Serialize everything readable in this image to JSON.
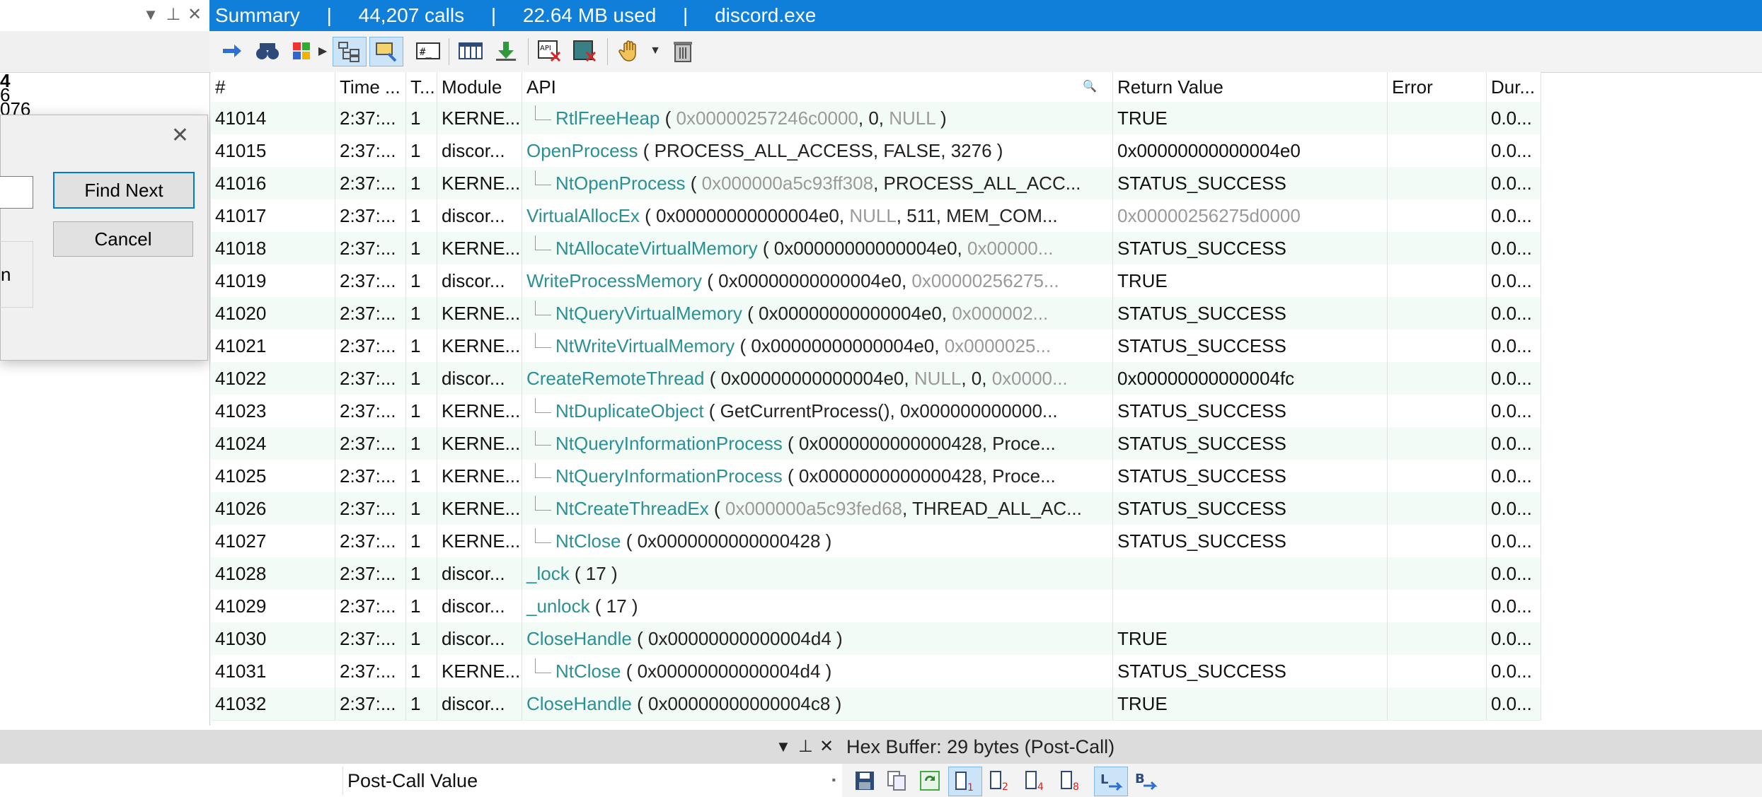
{
  "summary": {
    "title": "Summary",
    "calls": "44,207 calls",
    "memory": "22.64 MB used",
    "process": "discord.exe",
    "sep": "|"
  },
  "left_fragment": {
    "line1": "4",
    "line2": "6",
    "line3": "076"
  },
  "find_dialog": {
    "find_next": "Find Next",
    "cancel": "Cancel",
    "group_label_fragment": "n",
    "close_glyph": "✕"
  },
  "columns": {
    "num": "#",
    "time": "Time ...",
    "thread": "T...",
    "module": "Module",
    "api": "API",
    "ret": "Return Value",
    "error": "Error",
    "dur": "Dur..."
  },
  "rows": [
    {
      "num": "41014",
      "time": "2:37:...",
      "thread": "1",
      "module": "KERNE...",
      "indent": true,
      "name": "RtlFreeHeap",
      "args": [
        {
          "t": " ( ",
          "m": false
        },
        {
          "t": "0x00000257246c0000",
          "m": true
        },
        {
          "t": ", 0, ",
          "m": false
        },
        {
          "t": "NULL",
          "m": true
        },
        {
          "t": " )",
          "m": false
        }
      ],
      "ret": "TRUE",
      "ret_muted": false,
      "dur": "0.0..."
    },
    {
      "num": "41015",
      "time": "2:37:...",
      "thread": "1",
      "module": "discor...",
      "indent": false,
      "name": "OpenProcess",
      "args": [
        {
          "t": " ( PROCESS_ALL_ACCESS, FALSE, 3276 )",
          "m": false
        }
      ],
      "ret": "0x00000000000004e0",
      "ret_muted": false,
      "dur": "0.0..."
    },
    {
      "num": "41016",
      "time": "2:37:...",
      "thread": "1",
      "module": "KERNE...",
      "indent": true,
      "name": "NtOpenProcess",
      "args": [
        {
          "t": " ( ",
          "m": false
        },
        {
          "t": "0x000000a5c93ff308",
          "m": true
        },
        {
          "t": ", PROCESS_ALL_ACC...",
          "m": false
        }
      ],
      "ret": "STATUS_SUCCESS",
      "ret_muted": false,
      "dur": "0.0..."
    },
    {
      "num": "41017",
      "time": "2:37:...",
      "thread": "1",
      "module": "discor...",
      "indent": false,
      "name": "VirtualAllocEx",
      "args": [
        {
          "t": " ( 0x00000000000004e0, ",
          "m": false
        },
        {
          "t": "NULL",
          "m": true
        },
        {
          "t": ", 511, MEM_COM...",
          "m": false
        }
      ],
      "ret": "0x00000256275d0000",
      "ret_muted": true,
      "dur": "0.0..."
    },
    {
      "num": "41018",
      "time": "2:37:...",
      "thread": "1",
      "module": "KERNE...",
      "indent": true,
      "name": "NtAllocateVirtualMemory",
      "args": [
        {
          "t": " ( 0x00000000000004e0, ",
          "m": false
        },
        {
          "t": "0x00000...",
          "m": true
        }
      ],
      "ret": "STATUS_SUCCESS",
      "ret_muted": false,
      "dur": "0.0..."
    },
    {
      "num": "41019",
      "time": "2:37:...",
      "thread": "1",
      "module": "discor...",
      "indent": false,
      "name": "WriteProcessMemory",
      "args": [
        {
          "t": " ( 0x00000000000004e0, ",
          "m": false
        },
        {
          "t": "0x00000256275...",
          "m": true
        }
      ],
      "ret": "TRUE",
      "ret_muted": false,
      "dur": "0.0..."
    },
    {
      "num": "41020",
      "time": "2:37:...",
      "thread": "1",
      "module": "KERNE...",
      "indent": true,
      "name": "NtQueryVirtualMemory",
      "args": [
        {
          "t": " ( 0x00000000000004e0, ",
          "m": false
        },
        {
          "t": "0x000002...",
          "m": true
        }
      ],
      "ret": "STATUS_SUCCESS",
      "ret_muted": false,
      "dur": "0.0..."
    },
    {
      "num": "41021",
      "time": "2:37:...",
      "thread": "1",
      "module": "KERNE...",
      "indent": true,
      "name": "NtWriteVirtualMemory",
      "args": [
        {
          "t": " ( 0x00000000000004e0, ",
          "m": false
        },
        {
          "t": "0x0000025...",
          "m": true
        }
      ],
      "ret": "STATUS_SUCCESS",
      "ret_muted": false,
      "dur": "0.0..."
    },
    {
      "num": "41022",
      "time": "2:37:...",
      "thread": "1",
      "module": "discor...",
      "indent": false,
      "name": "CreateRemoteThread",
      "args": [
        {
          "t": " ( 0x00000000000004e0, ",
          "m": false
        },
        {
          "t": "NULL",
          "m": true
        },
        {
          "t": ", 0, ",
          "m": false
        },
        {
          "t": "0x0000...",
          "m": true
        }
      ],
      "ret": "0x00000000000004fc",
      "ret_muted": false,
      "dur": "0.0..."
    },
    {
      "num": "41023",
      "time": "2:37:...",
      "thread": "1",
      "module": "KERNE...",
      "indent": true,
      "name": "NtDuplicateObject",
      "args": [
        {
          "t": " ( GetCurrentProcess(), 0x000000000000...",
          "m": false
        }
      ],
      "ret": "STATUS_SUCCESS",
      "ret_muted": false,
      "dur": "0.0..."
    },
    {
      "num": "41024",
      "time": "2:37:...",
      "thread": "1",
      "module": "KERNE...",
      "indent": true,
      "name": "NtQueryInformationProcess",
      "args": [
        {
          "t": " ( 0x0000000000000428, Proce...",
          "m": false
        }
      ],
      "ret": "STATUS_SUCCESS",
      "ret_muted": false,
      "dur": "0.0..."
    },
    {
      "num": "41025",
      "time": "2:37:...",
      "thread": "1",
      "module": "KERNE...",
      "indent": true,
      "name": "NtQueryInformationProcess",
      "args": [
        {
          "t": " ( 0x0000000000000428, Proce...",
          "m": false
        }
      ],
      "ret": "STATUS_SUCCESS",
      "ret_muted": false,
      "dur": "0.0..."
    },
    {
      "num": "41026",
      "time": "2:37:...",
      "thread": "1",
      "module": "KERNE...",
      "indent": true,
      "name": "NtCreateThreadEx",
      "args": [
        {
          "t": " ( ",
          "m": false
        },
        {
          "t": "0x000000a5c93fed68",
          "m": true
        },
        {
          "t": ", THREAD_ALL_AC...",
          "m": false
        }
      ],
      "ret": "STATUS_SUCCESS",
      "ret_muted": false,
      "dur": "0.0..."
    },
    {
      "num": "41027",
      "time": "2:37:...",
      "thread": "1",
      "module": "KERNE...",
      "indent": true,
      "name": "NtClose",
      "args": [
        {
          "t": " ( 0x0000000000000428 )",
          "m": false
        }
      ],
      "ret": "STATUS_SUCCESS",
      "ret_muted": false,
      "dur": "0.0..."
    },
    {
      "num": "41028",
      "time": "2:37:...",
      "thread": "1",
      "module": "discor...",
      "indent": false,
      "name": "_lock",
      "args": [
        {
          "t": " ( 17 )",
          "m": false
        }
      ],
      "ret": "",
      "ret_muted": false,
      "dur": "0.0..."
    },
    {
      "num": "41029",
      "time": "2:37:...",
      "thread": "1",
      "module": "discor...",
      "indent": false,
      "name": "_unlock",
      "args": [
        {
          "t": " ( 17 )",
          "m": false
        }
      ],
      "ret": "",
      "ret_muted": false,
      "dur": "0.0..."
    },
    {
      "num": "41030",
      "time": "2:37:...",
      "thread": "1",
      "module": "discor...",
      "indent": false,
      "name": "CloseHandle",
      "args": [
        {
          "t": " ( 0x00000000000004d4 )",
          "m": false
        }
      ],
      "ret": "TRUE",
      "ret_muted": false,
      "dur": "0.0..."
    },
    {
      "num": "41031",
      "time": "2:37:...",
      "thread": "1",
      "module": "KERNE...",
      "indent": true,
      "name": "NtClose",
      "args": [
        {
          "t": " ( 0x00000000000004d4 )",
          "m": false
        }
      ],
      "ret": "STATUS_SUCCESS",
      "ret_muted": false,
      "dur": "0.0..."
    },
    {
      "num": "41032",
      "time": "2:37:...",
      "thread": "1",
      "module": "discor...",
      "indent": false,
      "name": "CloseHandle",
      "args": [
        {
          "t": " ( 0x00000000000004c8 )",
          "m": false
        }
      ],
      "ret": "TRUE",
      "ret_muted": false,
      "dur": "0.0..."
    }
  ],
  "bottom": {
    "hex_title": "Hex Buffer: 29 bytes (Post-Call)",
    "postcall_header": "Post-Call Value"
  },
  "icons": {
    "pane_menu": "▼",
    "pane_pin": "⊥",
    "pane_close": "✕"
  },
  "colors": {
    "summary_bar": "#0f7fd9",
    "api_name": "#2a9193",
    "row_alt": "#f2fbf6",
    "muted": "#9a9a9a"
  }
}
